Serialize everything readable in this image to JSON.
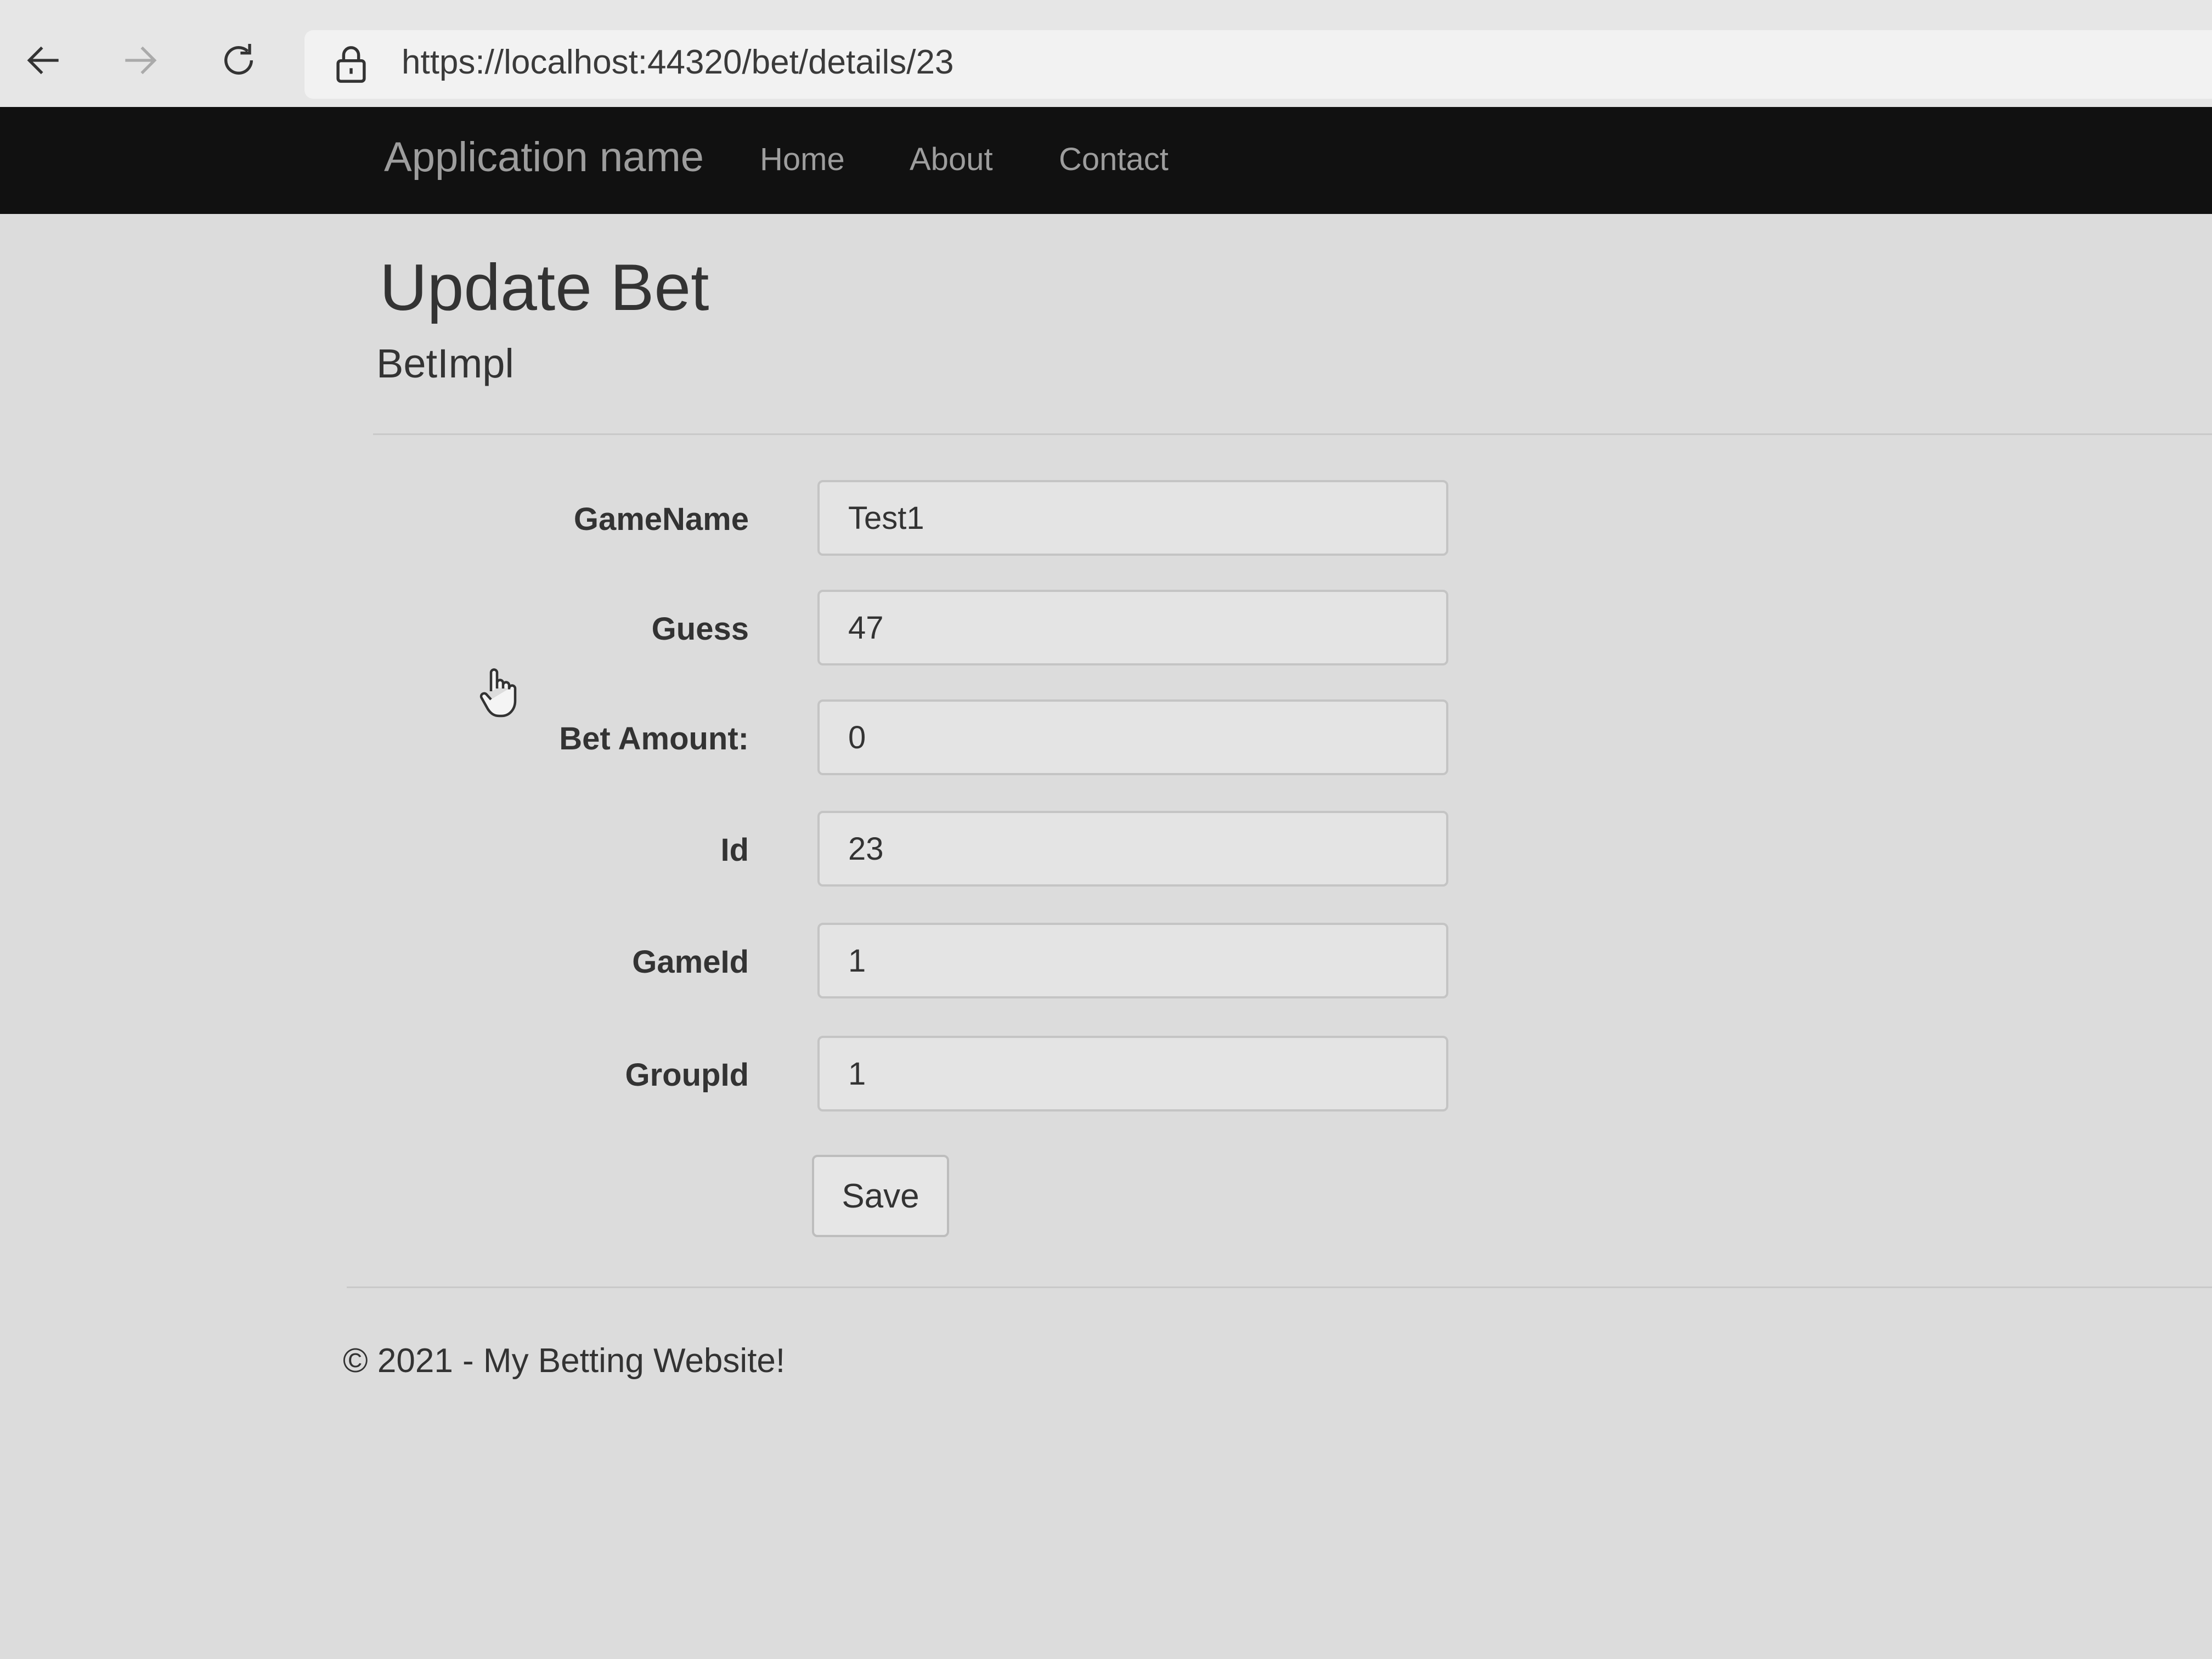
{
  "browser": {
    "url": "https://localhost:44320/bet/details/23"
  },
  "navbar": {
    "brand": "Application name",
    "links": [
      {
        "label": "Home"
      },
      {
        "label": "About"
      },
      {
        "label": "Contact"
      }
    ]
  },
  "page": {
    "title": "Update Bet",
    "subtitle": "BetImpl"
  },
  "form": {
    "fields": [
      {
        "label": "GameName",
        "value": "Test1"
      },
      {
        "label": "Guess",
        "value": "47"
      },
      {
        "label": "Bet Amount:",
        "value": "0"
      },
      {
        "label": "Id",
        "value": "23"
      },
      {
        "label": "GameId",
        "value": "1"
      },
      {
        "label": "GroupId",
        "value": "1"
      }
    ],
    "save_label": "Save"
  },
  "footer": {
    "text": "© 2021 - My Betting Website!"
  }
}
